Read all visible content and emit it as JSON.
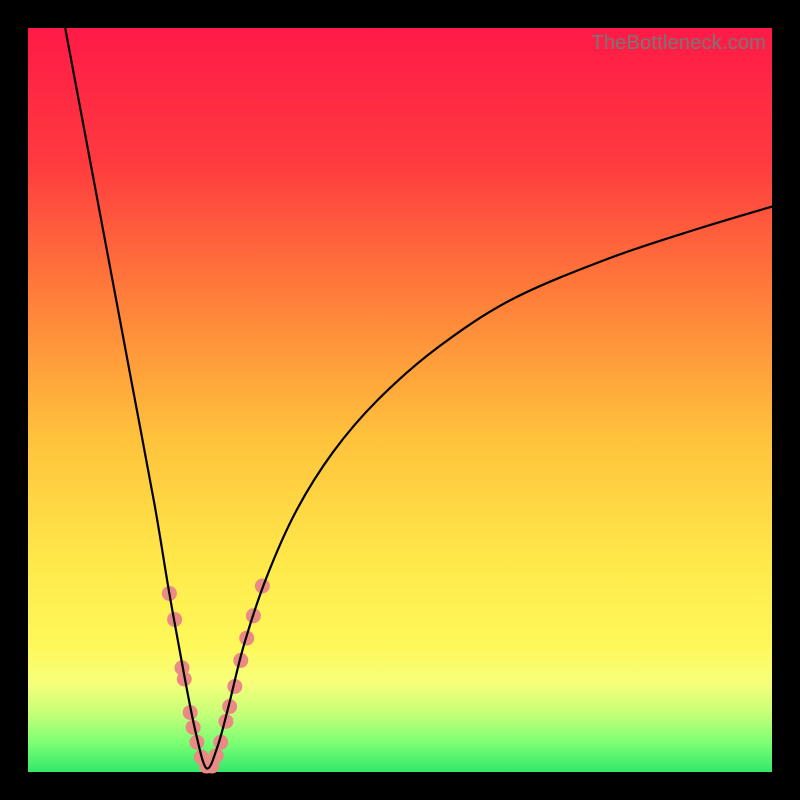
{
  "watermark": "TheBottleneck.com",
  "gradient": {
    "stops": [
      {
        "pct": 0,
        "color": "#ff1a47"
      },
      {
        "pct": 18,
        "color": "#ff3a3f"
      },
      {
        "pct": 35,
        "color": "#ff7a3a"
      },
      {
        "pct": 55,
        "color": "#ffc23c"
      },
      {
        "pct": 72,
        "color": "#ffe94a"
      },
      {
        "pct": 83,
        "color": "#fff85a"
      },
      {
        "pct": 88,
        "color": "#f7ff7a"
      },
      {
        "pct": 92,
        "color": "#c8ff78"
      },
      {
        "pct": 96,
        "color": "#7dff74"
      },
      {
        "pct": 100,
        "color": "#32e86a"
      }
    ]
  },
  "chart_data": {
    "type": "line",
    "title": "",
    "xlabel": "",
    "ylabel": "",
    "xlim": [
      0,
      100
    ],
    "ylim": [
      0,
      100
    ],
    "notes": "V-shaped bottleneck curve; minimum near x≈24 at y≈0. Left arm starts near (5,100) and descends steeply. Right arm rises and flattens, reaching ≈(100,76). Values are read off the plotted pixels; axes are unlabeled so units are percentages of plot area.",
    "series": [
      {
        "name": "bottleneck-curve",
        "x": [
          5,
          8,
          11,
          14,
          17,
          19,
          21,
          22.5,
          24,
          25.5,
          27,
          29,
          32,
          36,
          41,
          47,
          55,
          65,
          78,
          90,
          100
        ],
        "y": [
          100,
          84,
          68,
          52,
          36,
          24,
          13,
          5.5,
          0.5,
          3.5,
          9,
          17,
          26,
          35,
          43,
          50,
          57,
          63.5,
          69,
          73,
          76
        ]
      }
    ],
    "markers": {
      "name": "highlighted-points",
      "color": "#e98a84",
      "comment": "Salmon-colored dot clusters along the lower V section",
      "x": [
        19.0,
        19.7,
        20.7,
        21.0,
        21.8,
        22.2,
        22.7,
        23.3,
        24.0,
        24.7,
        25.3,
        25.9,
        26.6,
        27.1,
        27.8,
        28.6,
        29.4,
        30.3,
        31.5
      ],
      "y": [
        24.0,
        20.5,
        14.0,
        12.5,
        8.0,
        6.0,
        4.0,
        2.0,
        0.8,
        0.8,
        2.2,
        4.0,
        6.8,
        8.8,
        11.5,
        15.0,
        18.0,
        21.0,
        25.0
      ]
    }
  }
}
